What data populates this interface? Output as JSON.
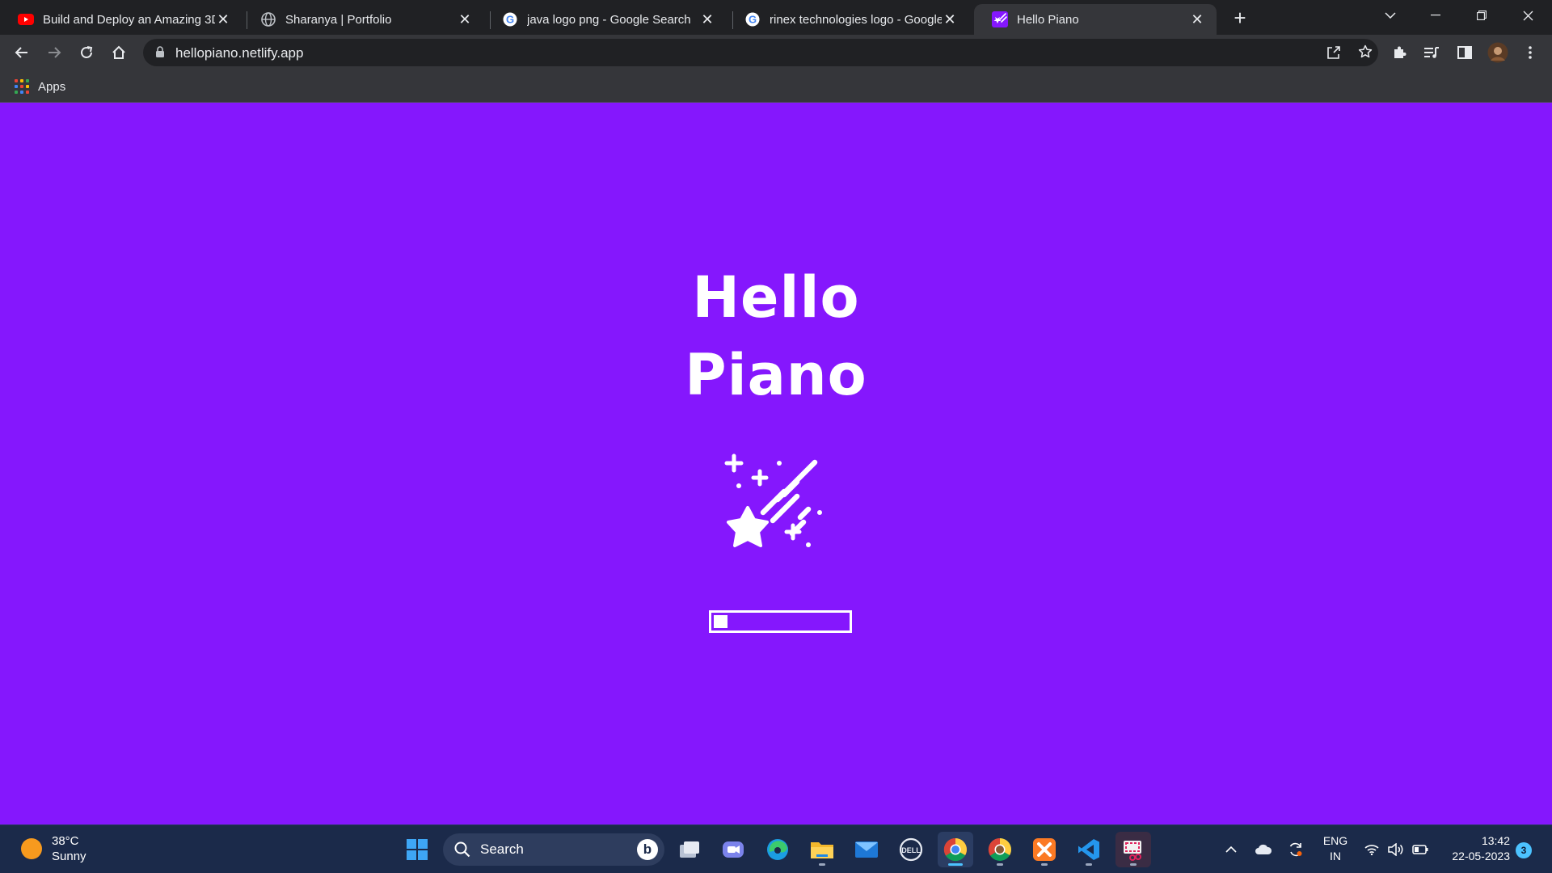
{
  "browser": {
    "tabs": [
      {
        "title": "Build and Deploy an Amazing 3D",
        "icon": "youtube-icon"
      },
      {
        "title": "Sharanya | Portfolio",
        "icon": "globe-icon"
      },
      {
        "title": "java logo png - Google Search",
        "icon": "google-icon"
      },
      {
        "title": "rinex technologies logo - Google",
        "icon": "google-icon"
      },
      {
        "title": "Hello Piano",
        "icon": "hello-piano-favicon",
        "active": true
      }
    ],
    "address": "hellopiano.netlify.app",
    "bookmarks": [
      {
        "label": "Apps",
        "icon": "apps-grid-icon"
      }
    ]
  },
  "page": {
    "title_line1": "Hello",
    "title_line2": "Piano",
    "illustration": "shooting-star-icon",
    "loading_progress": 0.1,
    "background_color": "#8517fd",
    "foreground_color": "#ffffff"
  },
  "taskbar": {
    "weather": {
      "temp": "38°C",
      "condition": "Sunny"
    },
    "search_label": "Search",
    "apps": [
      "windows-start-icon",
      "task-view-icon",
      "teams-chat-icon",
      "edge-icon",
      "file-explorer-icon",
      "mail-icon",
      "dell-icon",
      "chrome-icon",
      "chrome-profile-icon",
      "xampp-icon",
      "vscode-icon",
      "snipping-tool-icon"
    ],
    "language": {
      "line1": "ENG",
      "line2": "IN"
    },
    "time": "13:42",
    "date": "22-05-2023",
    "notification_count": "3"
  }
}
